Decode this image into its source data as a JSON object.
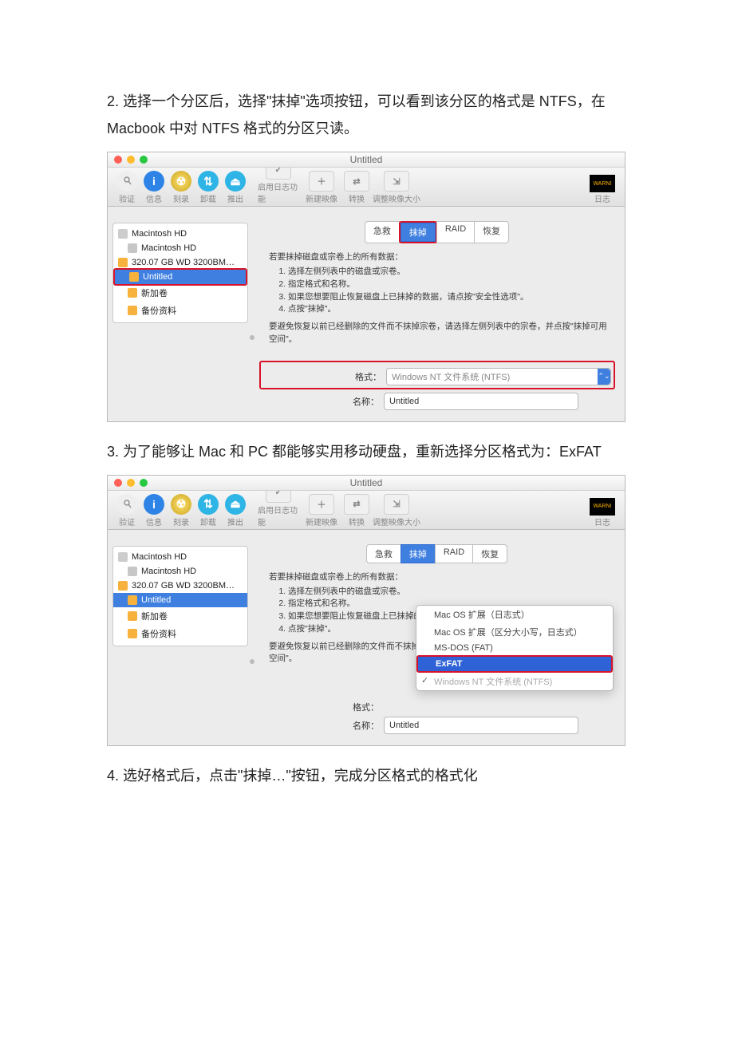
{
  "body_text": {
    "step2": "2. 选择一个分区后，选择\"抹掉\"选项按钮，可以看到该分区的格式是 NTFS，在 Macbook 中对 NTFS 格式的分区只读。",
    "step3": "3. 为了能够让 Mac 和 PC 都能够实用移动硬盘，重新选择分区格式为：ExFAT",
    "step4": "4. 选好格式后，点击\"抹掉…\"按钮，完成分区格式的格式化"
  },
  "window": {
    "title": "Untitled",
    "toolbar": {
      "verify": "验证",
      "info": "信息",
      "burn": "刻录",
      "unmount": "卸载",
      "eject": "推出",
      "enable_journal": "启用日志功能",
      "new_image": "新建映像",
      "convert": "转换",
      "resize_image": "调整映像大小",
      "log": "日志",
      "log_badge": "WARNI"
    },
    "sidebar": {
      "hd1": "Macintosh HD",
      "hd2": "Macintosh HD",
      "ext": "320.07 GB WD 3200BM…",
      "untitled": "Untitled",
      "newvol": "新加卷",
      "backup": "备份资料"
    },
    "tabs": {
      "first_aid": "急救",
      "erase": "抹掉",
      "raid": "RAID",
      "restore": "恢复"
    },
    "instructions": {
      "intro": "若要抹掉磁盘或宗卷上的所有数据：",
      "i1": "选择左侧列表中的磁盘或宗卷。",
      "i2": "指定格式和名称。",
      "i3": "如果您想要阻止恢复磁盘上已抹掉的数据，请点按\"安全性选项\"。",
      "i4": "点按\"抹掉\"。",
      "note": "要避免恢复以前已经删除的文件而不抹掉宗卷，请选择左侧列表中的宗卷，并点按\"抹掉可用空间\"。"
    },
    "fields": {
      "format": "格式：",
      "name": "名称：",
      "format_value_ntfs": "Windows NT 文件系统 (NTFS)",
      "name_value": "Untitled"
    },
    "dropdown": {
      "o1": "Mac OS 扩展（日志式）",
      "o2": "Mac OS 扩展（区分大小写，日志式）",
      "o3": "MS-DOS (FAT)",
      "o4": "ExFAT",
      "o5": "Windows NT 文件系统 (NTFS)"
    }
  }
}
